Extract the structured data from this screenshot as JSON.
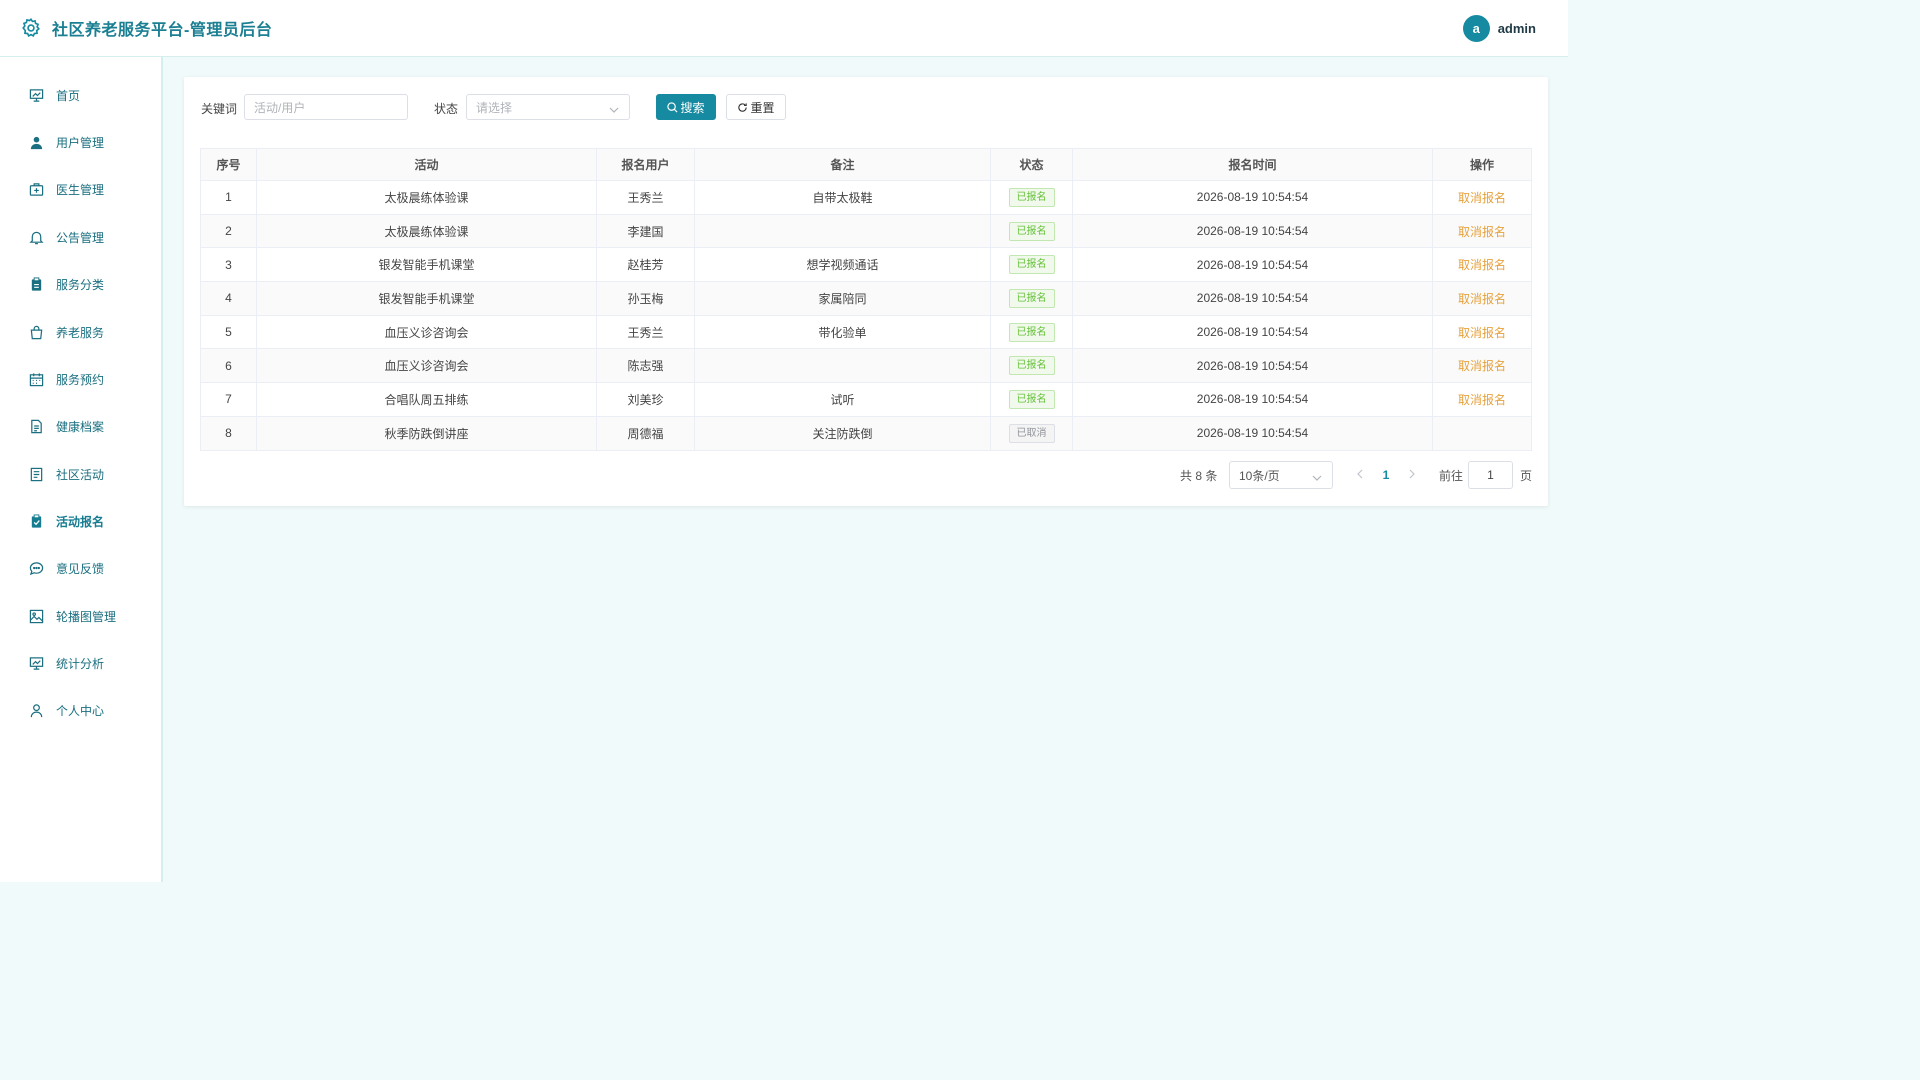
{
  "header": {
    "title": "社区养老服务平台-管理员后台",
    "avatar_letter": "a",
    "username": "admin"
  },
  "sidebar": {
    "items": [
      {
        "label": "首页",
        "icon": "chart-board-icon"
      },
      {
        "label": "用户管理",
        "icon": "user-icon"
      },
      {
        "label": "医生管理",
        "icon": "medical-kit-icon"
      },
      {
        "label": "公告管理",
        "icon": "bell-icon"
      },
      {
        "label": "服务分类",
        "icon": "clipboard-icon"
      },
      {
        "label": "养老服务",
        "icon": "shopping-bag-icon"
      },
      {
        "label": "服务预约",
        "icon": "calendar-icon"
      },
      {
        "label": "健康档案",
        "icon": "document-icon"
      },
      {
        "label": "社区活动",
        "icon": "list-document-icon"
      },
      {
        "label": "活动报名",
        "icon": "clipboard-check-icon",
        "active": true
      },
      {
        "label": "意见反馈",
        "icon": "chat-bubble-icon"
      },
      {
        "label": "轮播图管理",
        "icon": "picture-icon"
      },
      {
        "label": "统计分析",
        "icon": "chart-board-icon"
      },
      {
        "label": "个人中心",
        "icon": "user-outline-icon"
      }
    ]
  },
  "filters": {
    "keyword_label": "关键词",
    "keyword_placeholder": "活动/用户",
    "status_label": "状态",
    "status_placeholder": "请选择",
    "search_label": "搜索",
    "reset_label": "重置"
  },
  "table": {
    "columns": [
      "序号",
      "活动",
      "报名用户",
      "备注",
      "状态",
      "报名时间",
      "操作"
    ],
    "rows": [
      {
        "no": "1",
        "activity": "太极晨练体验课",
        "user": "王秀兰",
        "remark": "自带太极鞋",
        "status": "已报名",
        "time": "2026-08-19 10:54:54",
        "action": "取消报名"
      },
      {
        "no": "2",
        "activity": "太极晨练体验课",
        "user": "李建国",
        "remark": "",
        "status": "已报名",
        "time": "2026-08-19 10:54:54",
        "action": "取消报名"
      },
      {
        "no": "3",
        "activity": "银发智能手机课堂",
        "user": "赵桂芳",
        "remark": "想学视频通话",
        "status": "已报名",
        "time": "2026-08-19 10:54:54",
        "action": "取消报名"
      },
      {
        "no": "4",
        "activity": "银发智能手机课堂",
        "user": "孙玉梅",
        "remark": "家属陪同",
        "status": "已报名",
        "time": "2026-08-19 10:54:54",
        "action": "取消报名"
      },
      {
        "no": "5",
        "activity": "血压义诊咨询会",
        "user": "王秀兰",
        "remark": "带化验单",
        "status": "已报名",
        "time": "2026-08-19 10:54:54",
        "action": "取消报名"
      },
      {
        "no": "6",
        "activity": "血压义诊咨询会",
        "user": "陈志强",
        "remark": "",
        "status": "已报名",
        "time": "2026-08-19 10:54:54",
        "action": "取消报名"
      },
      {
        "no": "7",
        "activity": "合唱队周五排练",
        "user": "刘美珍",
        "remark": "试听",
        "status": "已报名",
        "time": "2026-08-19 10:54:54",
        "action": "取消报名"
      },
      {
        "no": "8",
        "activity": "秋季防跌倒讲座",
        "user": "周德福",
        "remark": "关注防跌倒",
        "status": "已取消",
        "time": "2026-08-19 10:54:54",
        "action": ""
      }
    ]
  },
  "pagination": {
    "total_text": "共 8 条",
    "page_size": "10条/页",
    "current_page": "1",
    "goto_label": "前往",
    "goto_value": "1",
    "page_suffix": "页"
  },
  "colors": {
    "primary": "#168aa0",
    "success": "#67c23a",
    "warning": "#e6a23c"
  }
}
